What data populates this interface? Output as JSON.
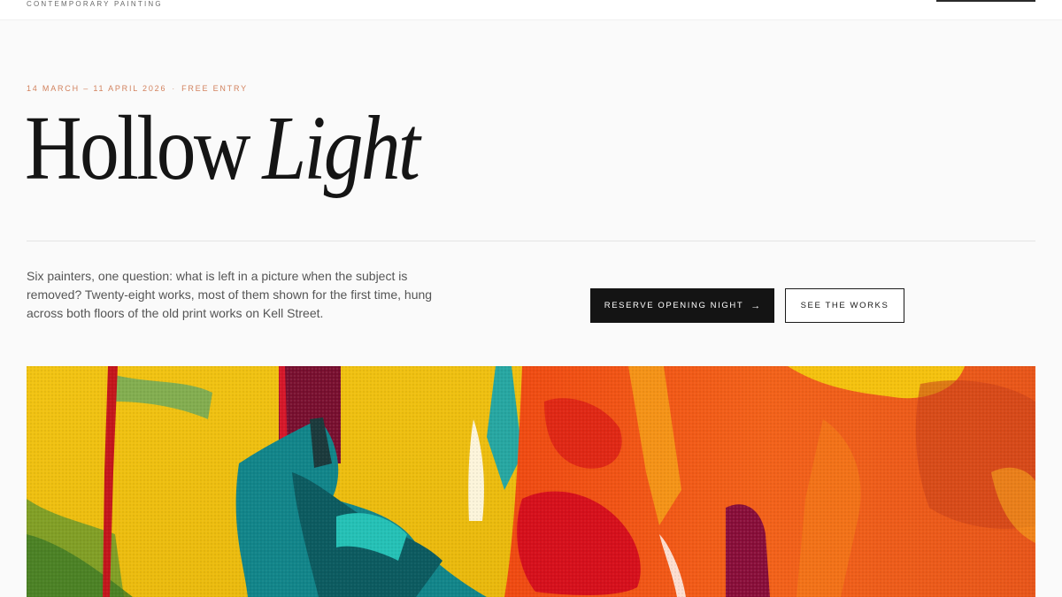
{
  "header": {
    "brand_tagline": "CONTEMPORARY PAINTING"
  },
  "hero": {
    "dates": "14 MARCH – 11 APRIL 2026",
    "separator": "·",
    "entry": "FREE ENTRY",
    "title_regular": "Hollow",
    "title_italic": "Light",
    "intro": "Six painters, one question: what is left in a picture when the subject is removed? Twenty-eight works, most of them shown for the first time, hung across both floors of the old print works on Kell Street.",
    "primary_button": {
      "label": "RESERVE OPENING NIGHT",
      "icon": "arrow-right-icon",
      "arrow": "→"
    },
    "secondary_button": {
      "label": "SEE THE WORKS"
    }
  },
  "colors": {
    "accent": "#d2825e",
    "ink": "#141414",
    "background": "#fafafa"
  }
}
